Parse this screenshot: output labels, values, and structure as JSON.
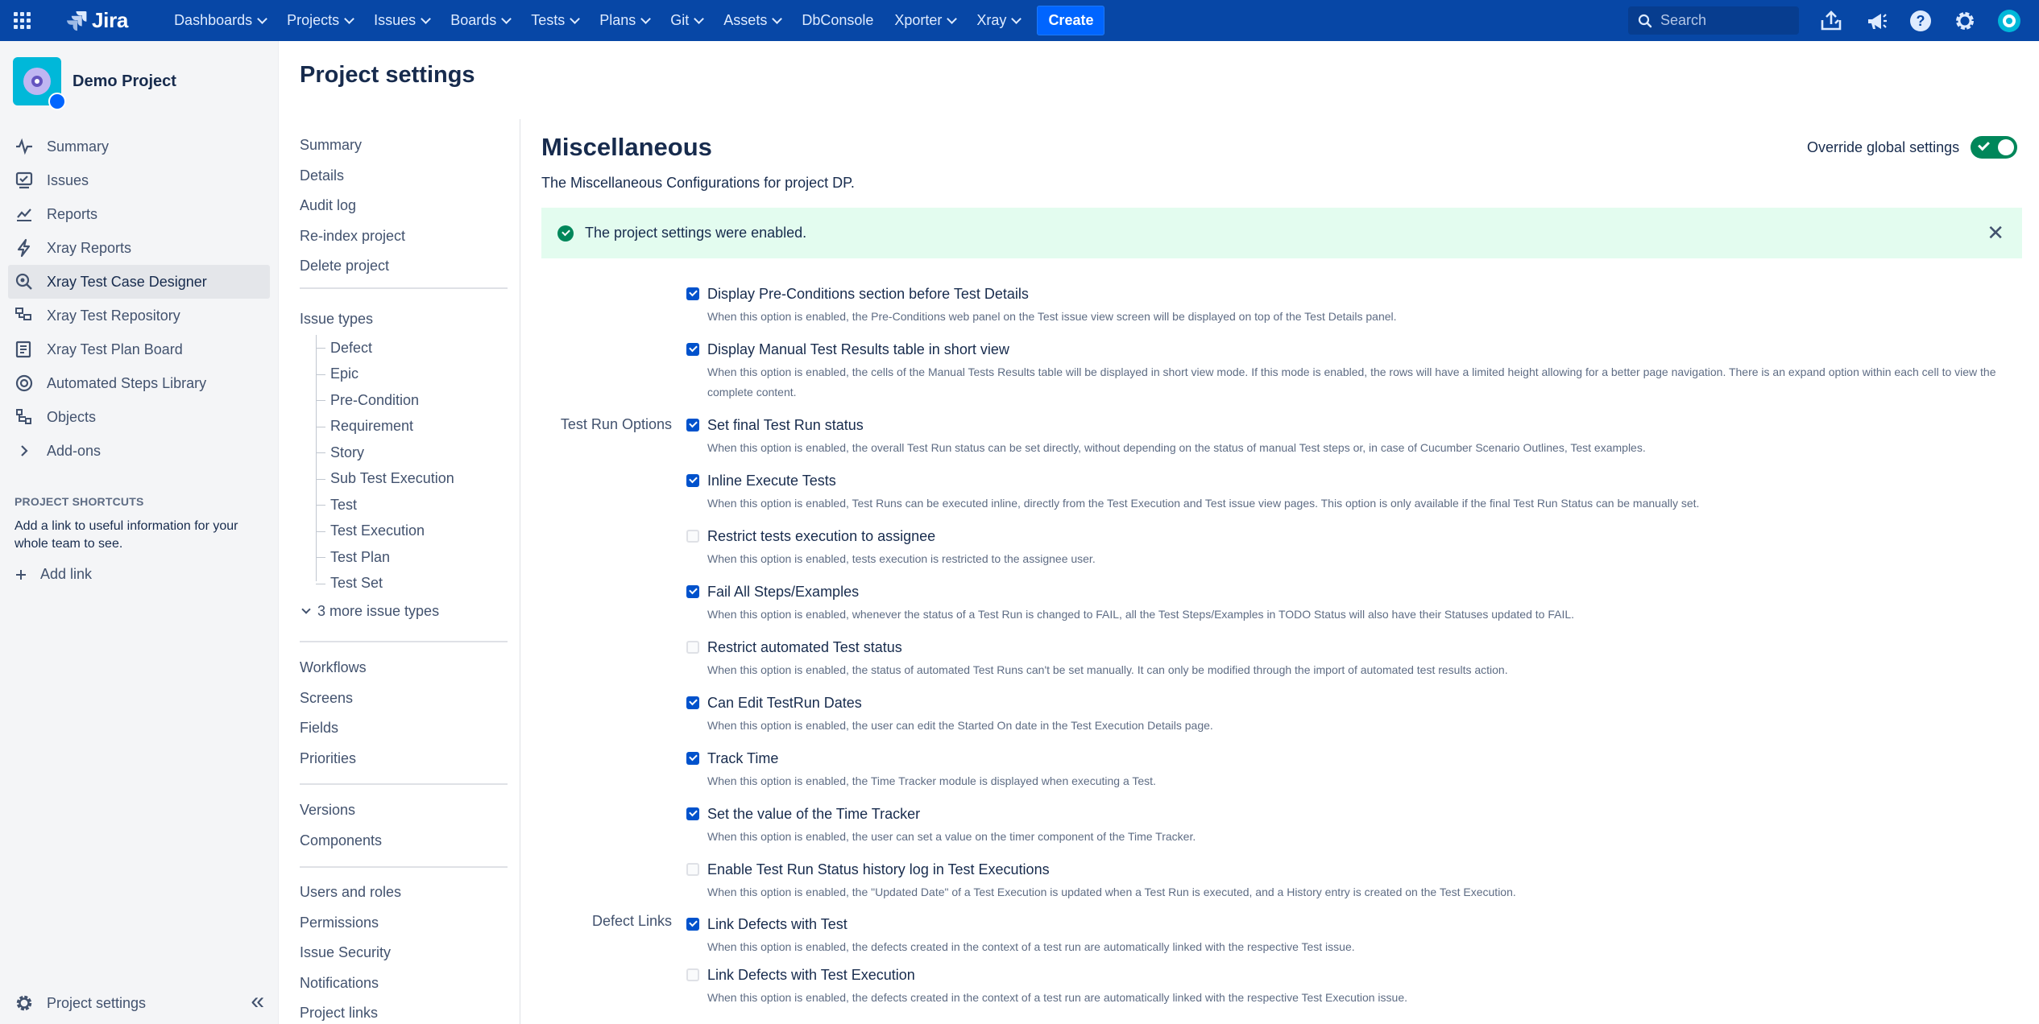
{
  "topnav": {
    "logo_text": "Jira",
    "items": [
      {
        "label": "Dashboards",
        "chevron": true
      },
      {
        "label": "Projects",
        "chevron": true
      },
      {
        "label": "Issues",
        "chevron": true
      },
      {
        "label": "Boards",
        "chevron": true
      },
      {
        "label": "Tests",
        "chevron": true
      },
      {
        "label": "Plans",
        "chevron": true
      },
      {
        "label": "Git",
        "chevron": true
      },
      {
        "label": "Assets",
        "chevron": true
      },
      {
        "label": "DbConsole",
        "chevron": false
      },
      {
        "label": "Xporter",
        "chevron": true
      },
      {
        "label": "Xray",
        "chevron": true
      }
    ],
    "create_label": "Create",
    "search_placeholder": "Search",
    "right_icons": [
      "upload-icon",
      "megaphone-icon",
      "help-icon",
      "gear-icon",
      "user-avatar-icon"
    ],
    "brand_color": "#0747a6"
  },
  "sidebar": {
    "project_name": "Demo Project",
    "items": [
      {
        "label": "Summary",
        "icon": "activity-icon",
        "active": false
      },
      {
        "label": "Issues",
        "icon": "issues-icon",
        "active": false
      },
      {
        "label": "Reports",
        "icon": "chart-icon",
        "active": false
      },
      {
        "label": "Xray Reports",
        "icon": "bolt-icon",
        "active": false
      },
      {
        "label": "Xray Test Case Designer",
        "icon": "designer-icon",
        "active": true
      },
      {
        "label": "Xray Test Repository",
        "icon": "repository-icon",
        "active": false
      },
      {
        "label": "Xray Test Plan Board",
        "icon": "board-icon",
        "active": false
      },
      {
        "label": "Automated Steps Library",
        "icon": "library-icon",
        "active": false
      },
      {
        "label": "Objects",
        "icon": "objects-icon",
        "active": false
      },
      {
        "label": "Add-ons",
        "icon": "chevron-right-icon",
        "active": false
      }
    ],
    "shortcuts_heading": "PROJECT SHORTCUTS",
    "shortcuts_desc": "Add a link to useful information for your whole team to see.",
    "add_link_label": "Add link",
    "footer_label": "Project settings"
  },
  "page_title": "Project settings",
  "settings_nav": {
    "group1": [
      "Summary",
      "Details",
      "Audit log",
      "Re-index project",
      "Delete project"
    ],
    "issue_types_title": "Issue types",
    "issue_types": [
      "Defect",
      "Epic",
      "Pre-Condition",
      "Requirement",
      "Story",
      "Sub Test Execution",
      "Test",
      "Test Execution",
      "Test Plan",
      "Test Set"
    ],
    "more_types_label": "3 more issue types",
    "group2": [
      "Workflows",
      "Screens",
      "Fields",
      "Priorities"
    ],
    "group3": [
      "Versions",
      "Components"
    ],
    "group4": [
      "Users and roles",
      "Permissions",
      "Issue Security",
      "Notifications",
      "Project links"
    ]
  },
  "content": {
    "title": "Miscellaneous",
    "description": "The Miscellaneous Configurations for project DP.",
    "override_label": "Override global settings",
    "override_on": true,
    "flag_message": "The project settings were enabled.",
    "group_labels": {
      "test_run": "Test Run Options",
      "defect_links": "Defect Links"
    },
    "options": [
      {
        "label": "Display Pre-Conditions section before Test Details",
        "checked": true,
        "desc": "When this option is enabled, the Pre-Conditions web panel on the Test issue view screen will be displayed on top of the Test Details panel."
      },
      {
        "label": "Display Manual Test Results table in short view",
        "checked": true,
        "desc": "When this option is enabled, the cells of the Manual Tests Results table will be displayed in short view mode. If this mode is enabled, the rows will have a limited height allowing for a better page navigation. There is an expand option within each cell to view the complete content."
      },
      {
        "label": "Set final Test Run status",
        "checked": true,
        "desc": "When this option is enabled, the overall Test Run status can be set directly, without depending on the status of manual Test steps or, in case of Cucumber Scenario Outlines, Test examples."
      },
      {
        "label": "Inline Execute Tests",
        "checked": true,
        "desc": "When this option is enabled, Test Runs can be executed inline, directly from the Test Execution and Test issue view pages. This option is only available if the final Test Run Status can be manually set."
      },
      {
        "label": "Restrict tests execution to assignee",
        "checked": false,
        "desc": "When this option is enabled, tests execution is restricted to the assignee user."
      },
      {
        "label": "Fail All Steps/Examples",
        "checked": true,
        "desc": "When this option is enabled, whenever the status of a Test Run is changed to FAIL, all the Test Steps/Examples in TODO Status will also have their Statuses updated to FAIL."
      },
      {
        "label": "Restrict automated Test status",
        "checked": false,
        "desc": "When this option is enabled, the status of automated Test Runs can't be set manually. It can only be modified through the import of automated test results action."
      },
      {
        "label": "Can Edit TestRun Dates",
        "checked": true,
        "desc": "When this option is enabled, the user can edit the Started On date in the Test Execution Details page."
      },
      {
        "label": "Track Time",
        "checked": true,
        "desc": "When this option is enabled, the Time Tracker module is displayed when executing a Test."
      },
      {
        "label": "Set the value of the Time Tracker",
        "checked": true,
        "desc": "When this option is enabled, the user can set a value on the timer component of the Time Tracker."
      },
      {
        "label": "Enable Test Run Status history log in Test Executions",
        "checked": false,
        "desc": "When this option is enabled, the \"Updated Date\" of a Test Execution is updated when a Test Run is executed, and a History entry is created on the Test Execution."
      },
      {
        "label": "Link Defects with Test",
        "checked": true,
        "desc": "When this option is enabled, the defects created in the context of a test run are automatically linked with the respective Test issue."
      },
      {
        "label": "Link Defects with Test Execution",
        "checked": false,
        "desc": "When this option is enabled, the defects created in the context of a test run are automatically linked with the respective Test Execution issue."
      }
    ]
  }
}
